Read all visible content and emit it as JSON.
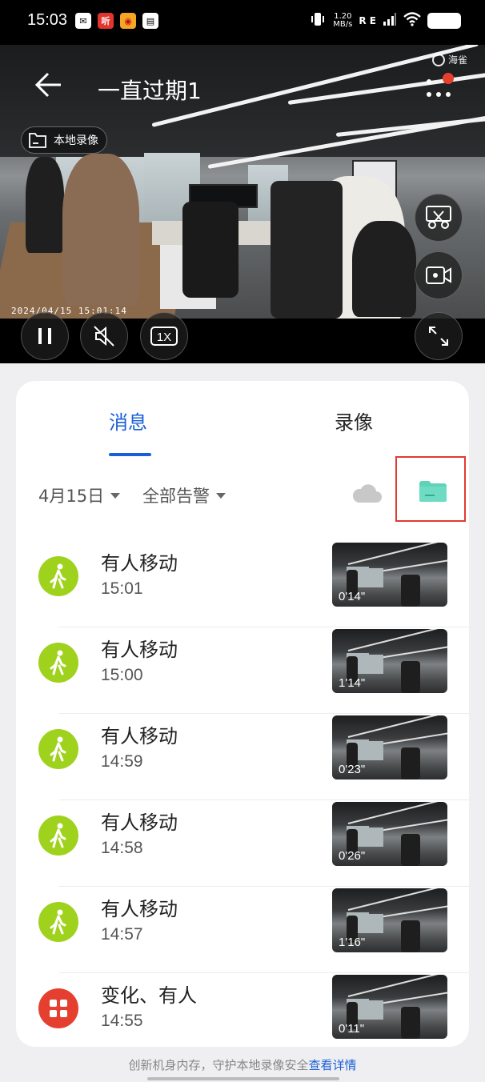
{
  "status_bar": {
    "time": "15:03",
    "net_speed": "1.20\nMB/s",
    "battery": "",
    "network": "R E",
    "icons": [
      "mail-icon",
      "ting-app-icon",
      "weibo-icon",
      "wallet-icon",
      "vibrate-icon",
      "signal-icon",
      "wifi-icon",
      "battery-icon"
    ]
  },
  "video": {
    "title": "一直过期1",
    "logo_text": "海雀",
    "local_recording_label": "本地录像",
    "timestamp": "2024/04/15 15:01:14",
    "speed_label": "1X"
  },
  "tabs": [
    {
      "label": "消息",
      "active": true
    },
    {
      "label": "录像",
      "active": false
    }
  ],
  "filters": {
    "date": "4月15日",
    "alert_type": "全部告警"
  },
  "events": [
    {
      "title": "有人移动",
      "time": "15:01",
      "duration": "0'14\"",
      "icon": "walking-person-icon",
      "color": "#9fd21c"
    },
    {
      "title": "有人移动",
      "time": "15:00",
      "duration": "1'14\"",
      "icon": "walking-person-icon",
      "color": "#9fd21c"
    },
    {
      "title": "有人移动",
      "time": "14:59",
      "duration": "0'23\"",
      "icon": "walking-person-icon",
      "color": "#9fd21c"
    },
    {
      "title": "有人移动",
      "time": "14:58",
      "duration": "0'26\"",
      "icon": "walking-person-icon",
      "color": "#9fd21c"
    },
    {
      "title": "有人移动",
      "time": "14:57",
      "duration": "1'16\"",
      "icon": "walking-person-icon",
      "color": "#9fd21c"
    },
    {
      "title": "变化、有人",
      "time": "14:55",
      "duration": "0'11\"",
      "icon": "grid-icon",
      "color": "#e5402f"
    }
  ],
  "footer": {
    "text": "创新机身内存，守护本地录像安全",
    "link": "查看详情"
  },
  "colors": {
    "accent": "#1a5fd8",
    "motion": "#9fd21c",
    "alert": "#e5402f",
    "folder": "#5fd3b8",
    "highlight_box": "#e23a33"
  }
}
